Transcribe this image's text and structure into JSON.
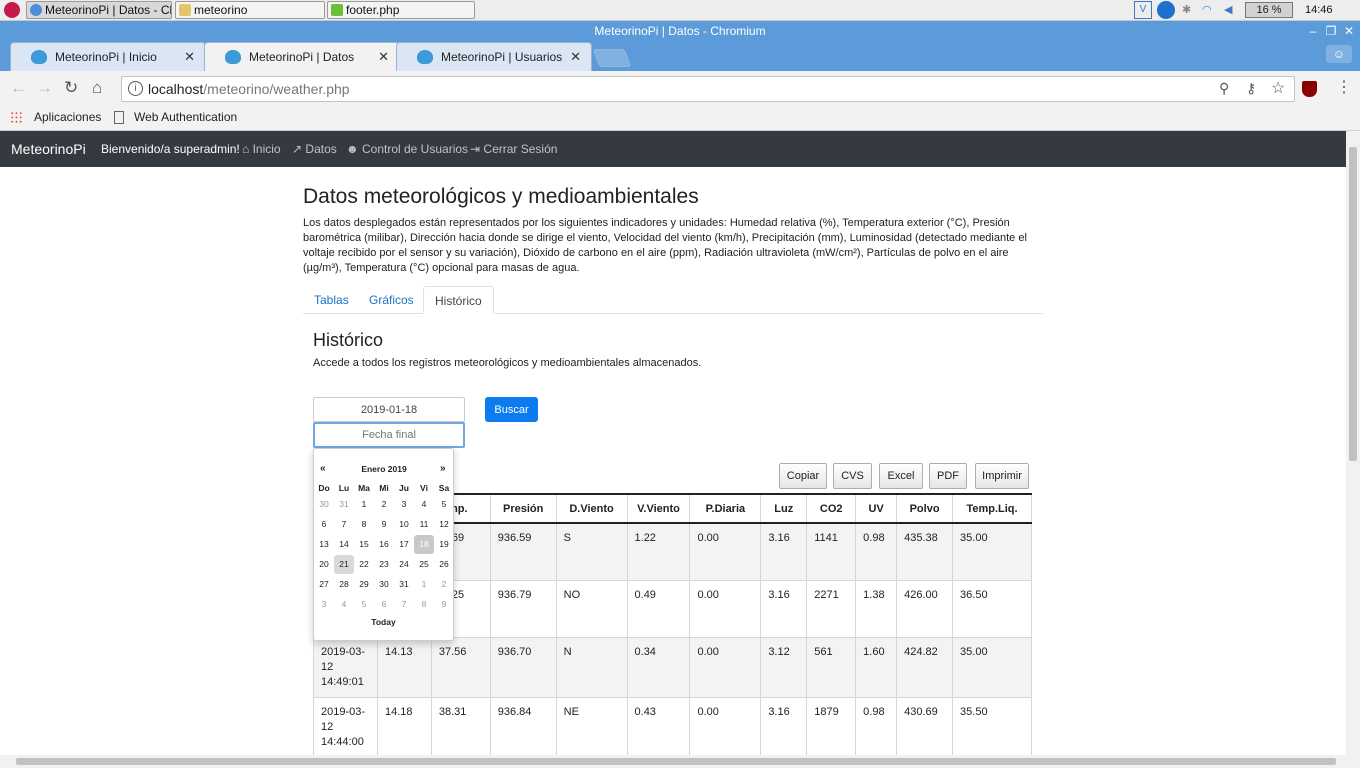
{
  "taskbar": {
    "windows": [
      "MeteorinoPi | Datos - Ch...",
      "meteorino",
      "footer.php"
    ],
    "battery": "16 %",
    "clock": "14:46"
  },
  "window": {
    "title": "MeteorinoPi | Datos - Chromium"
  },
  "tabs": [
    {
      "label": "MeteorinoPi | Inicio"
    },
    {
      "label": "MeteorinoPi | Datos"
    },
    {
      "label": "MeteorinoPi | Usuarios"
    }
  ],
  "address": {
    "host": "localhost",
    "path": "/meteorino/weather.php"
  },
  "bookmarks": [
    "Aplicaciones",
    "Web Authentication"
  ],
  "navbar": {
    "brand": "MeteorinoPi",
    "welcome": "Bienvenido/a superadmin!",
    "links": [
      "Inicio",
      "Datos",
      "Control de Usuarios",
      "Cerrar Sesión"
    ]
  },
  "page": {
    "title": "Datos meteorológicos y medioambientales",
    "description": "Los datos desplegados están representados por los siguientes indicadores y unidades: Humedad relativa (%), Temperatura exterior (°C), Presión barométrica (milibar), Dirección hacia donde se dirige el viento, Velocidad del viento (km/h), Precipitación (mm), Luminosidad (detectado mediante el voltaje recibido por el sensor y su variación), Dióxido de carbono en el aire (ppm), Radiación ultravioleta (mW/cm²), Partículas de polvo en el aire (µg/m³), Temperatura (°C) opcional para masas de agua.",
    "tabs": [
      "Tablas",
      "Gráficos",
      "Histórico"
    ],
    "section_title": "Histórico",
    "section_desc": "Accede a todos los registros meteorológicos y medioambientales almacenados."
  },
  "search": {
    "start_value": "2019-01-18",
    "end_placeholder": "Fecha final",
    "button": "Buscar"
  },
  "export_buttons": [
    "Copiar",
    "CVS",
    "Excel",
    "PDF",
    "Imprimir"
  ],
  "table": {
    "headers": [
      "",
      "",
      "emp.",
      "Presión",
      "D.Viento",
      "V.Viento",
      "P.Diaria",
      "Luz",
      "CO2",
      "UV",
      "Polvo",
      "Temp.Liq."
    ],
    "rows": [
      [
        "",
        "",
        "69",
        "936.59",
        "S",
        "1.22",
        "0.00",
        "3.16",
        "1141",
        "0.98",
        "435.38",
        "35.00"
      ],
      [
        "",
        "",
        "25",
        "936.79",
        "NO",
        "0.49",
        "0.00",
        "3.16",
        "2271",
        "1.38",
        "426.00",
        "36.50"
      ],
      [
        "2019-03-12 14:49:01",
        "14.13",
        "37.56",
        "936.70",
        "N",
        "0.34",
        "0.00",
        "3.12",
        "561",
        "1.60",
        "424.82",
        "35.00"
      ],
      [
        "2019-03-12 14:44:00",
        "14.18",
        "38.31",
        "936.84",
        "NE",
        "0.43",
        "0.00",
        "3.16",
        "1879",
        "0.98",
        "430.69",
        "35.50"
      ]
    ]
  },
  "datepicker": {
    "prev": "«",
    "next": "»",
    "month": "Enero 2019",
    "weekdays": [
      "Do",
      "Lu",
      "Ma",
      "Mi",
      "Ju",
      "Vi",
      "Sa"
    ],
    "weeks": [
      [
        "30",
        "31",
        "1",
        "2",
        "3",
        "4",
        "5"
      ],
      [
        "6",
        "7",
        "8",
        "9",
        "10",
        "11",
        "12"
      ],
      [
        "13",
        "14",
        "15",
        "16",
        "17",
        "18",
        "19"
      ],
      [
        "20",
        "21",
        "22",
        "23",
        "24",
        "25",
        "26"
      ],
      [
        "27",
        "28",
        "29",
        "30",
        "31",
        "1",
        "2"
      ],
      [
        "3",
        "4",
        "5",
        "6",
        "7",
        "8",
        "9"
      ]
    ],
    "today": "Today"
  }
}
